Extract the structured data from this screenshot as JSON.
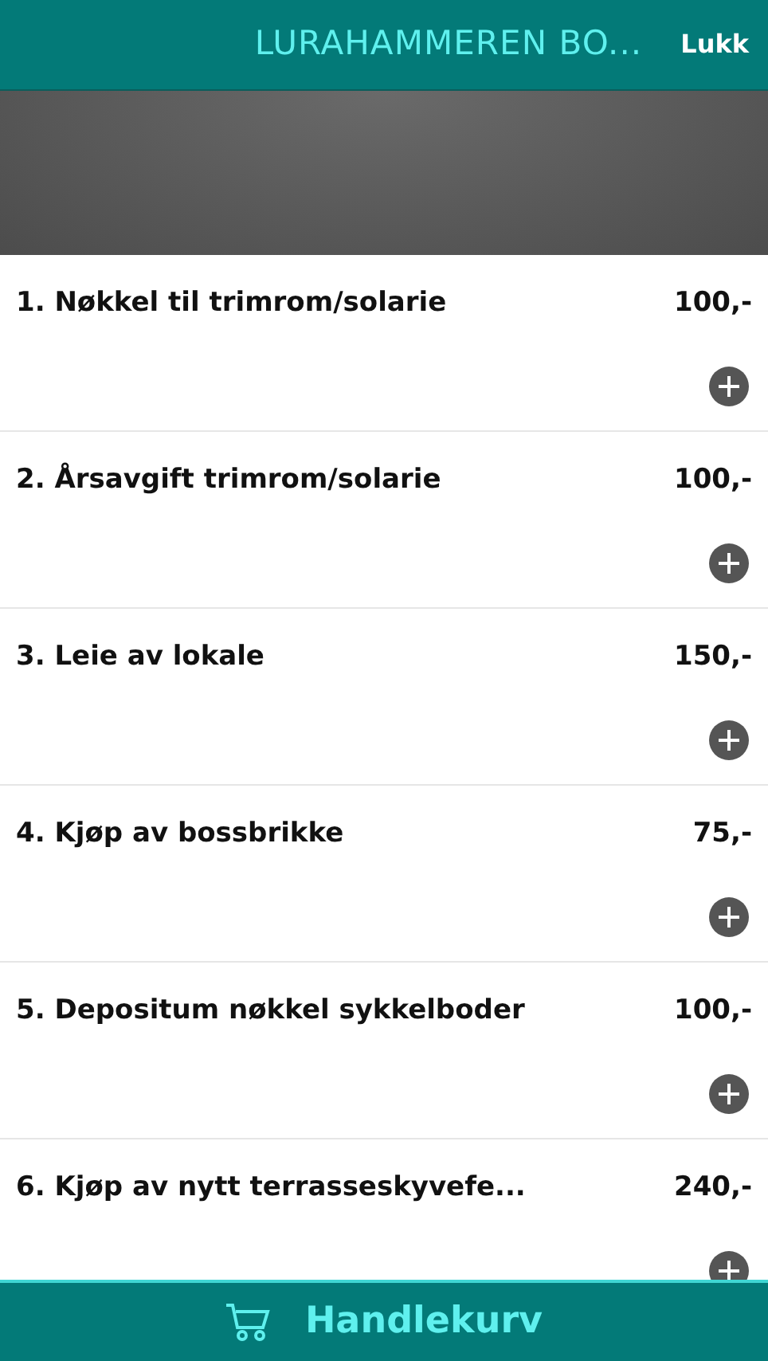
{
  "header": {
    "title": "LURAHAMMEREN BO...",
    "close": "Lukk"
  },
  "items": [
    {
      "name": "1. Nøkkel til trimrom/solarie",
      "price": "100,-"
    },
    {
      "name": "2. Årsavgift trimrom/solarie",
      "price": "100,-"
    },
    {
      "name": "3. Leie av lokale",
      "price": "150,-"
    },
    {
      "name": "4. Kjøp av bossbrikke",
      "price": "75,-"
    },
    {
      "name": "5. Depositum nøkkel sykkelboder",
      "price": "100,-"
    },
    {
      "name": "6. Kjøp av nytt terrasseskyvefe...",
      "price": "240,-"
    }
  ],
  "cart_button": "Handlekurv"
}
